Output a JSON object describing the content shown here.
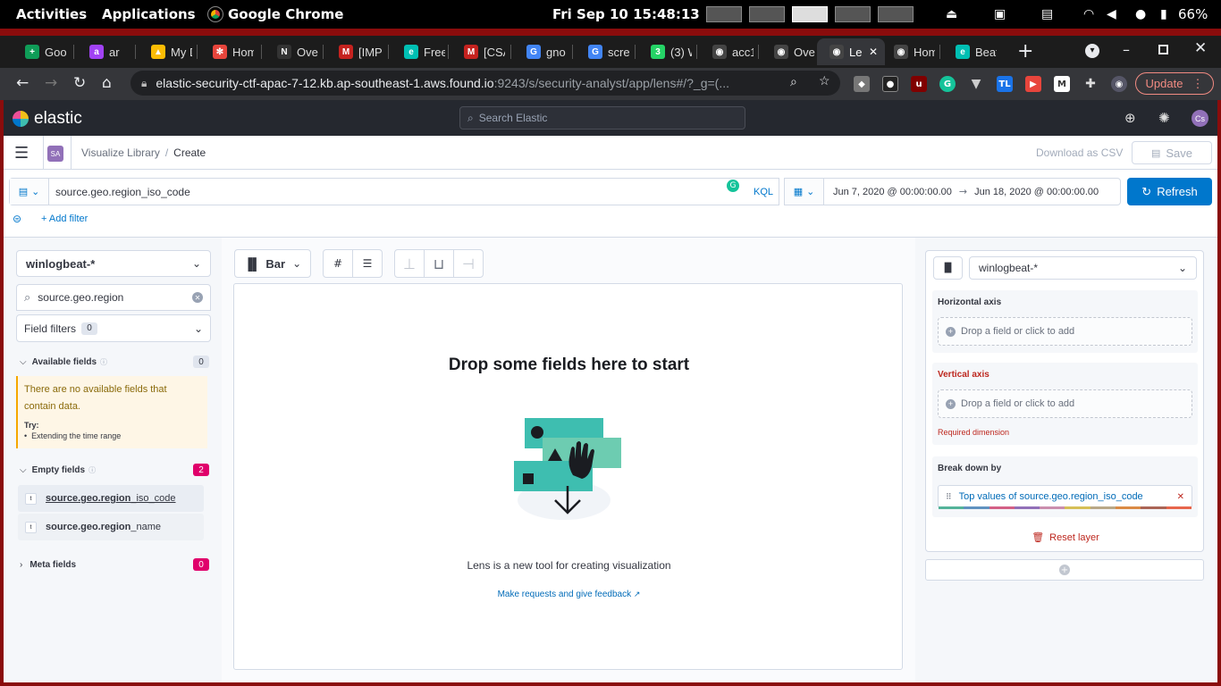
{
  "gnome": {
    "activities": "Activities",
    "applications": "Applications",
    "app_name": "Google Chrome",
    "clock": "Fri Sep 10  15:48:13",
    "battery": "66%"
  },
  "tabs": [
    {
      "label": "Goo",
      "color": "#0f9d58",
      "glyph": "+"
    },
    {
      "label": "ar",
      "color": "#a142f4",
      "glyph": "a"
    },
    {
      "label": "My D",
      "color": "#fbbc04",
      "glyph": "▲"
    },
    {
      "label": "Hom",
      "color": "#e8453c",
      "glyph": "✻"
    },
    {
      "label": "Over",
      "color": "#333333",
      "glyph": "N"
    },
    {
      "label": "[IMP",
      "color": "#c5221f",
      "glyph": "M"
    },
    {
      "label": "Free",
      "color": "#00bfb3",
      "glyph": "e"
    },
    {
      "label": "[CSA",
      "color": "#c5221f",
      "glyph": "M"
    },
    {
      "label": "gno",
      "color": "#4285f4",
      "glyph": "G"
    },
    {
      "label": "scre",
      "color": "#4285f4",
      "glyph": "G"
    },
    {
      "label": "(3) W",
      "color": "#25d366",
      "glyph": "3"
    },
    {
      "label": "acc1",
      "color": "#444444",
      "glyph": "◉"
    },
    {
      "label": "Over",
      "color": "#444444",
      "glyph": "◉"
    },
    {
      "label": "Le",
      "color": "#444444",
      "glyph": "◉",
      "active": true
    },
    {
      "label": "Hom",
      "color": "#444444",
      "glyph": "◉"
    },
    {
      "label": "Beat",
      "color": "#00bfb3",
      "glyph": "e"
    }
  ],
  "browser": {
    "url_host": "elastic-security-ctf-apac-7-12.kb.ap-southeast-1.aws.found.io",
    "url_rest": ":9243/s/security-analyst/app/lens#/?_g=(...",
    "update_label": "Update"
  },
  "kibana": {
    "brand": "elastic",
    "search_placeholder": "Search Elastic",
    "space_badge": "SA",
    "avatar": "Cs",
    "breadcrumb_1": "Visualize Library",
    "breadcrumb_sep": "/",
    "breadcrumb_2": "Create",
    "download_csv": "Download as CSV",
    "save": "Save"
  },
  "query": {
    "text": "source.geo.region_iso_code",
    "language": "KQL",
    "date_start": "Jun 7, 2020 @ 00:00:00.00",
    "date_arrow": "→",
    "date_end": "Jun 18, 2020 @ 00:00:00.00",
    "refresh": "Refresh",
    "add_filter": "+ Add filter"
  },
  "sidebar": {
    "index_pattern": "winlogbeat-*",
    "field_search": "source.geo.region",
    "field_filters": "Field filters",
    "field_filters_count": "0",
    "available_label": "Available fields",
    "available_count": "0",
    "no_fields_msg": "There are no available fields that contain data.",
    "try_label": "Try:",
    "try_item": "Extending the time range",
    "empty_label": "Empty fields",
    "empty_count": "2",
    "fields": [
      {
        "bold": "source.geo.region",
        "rest": "_iso_code"
      },
      {
        "bold": "source.geo.region",
        "rest": "_name"
      }
    ],
    "meta_label": "Meta fields",
    "meta_count": "0"
  },
  "workspace": {
    "chart_type": "Bar",
    "title": "Drop some fields here to start",
    "desc": "Lens is a new tool for creating visualization",
    "feedback": "Make requests and give feedback"
  },
  "config": {
    "index_pattern": "winlogbeat-*",
    "horizontal_axis": "Horizontal axis",
    "drop_placeholder": "Drop a field or click to add",
    "vertical_axis": "Vertical axis",
    "required": "Required dimension",
    "breakdown": "Break down by",
    "breakdown_value": "Top values of source.geo.region_iso_code",
    "reset_layer": "Reset layer",
    "palette": [
      "#54b399",
      "#6092c0",
      "#d36086",
      "#9170b8",
      "#ca8eae",
      "#d6bf57",
      "#b9a888",
      "#da8b45",
      "#aa6556",
      "#e7664c"
    ]
  }
}
